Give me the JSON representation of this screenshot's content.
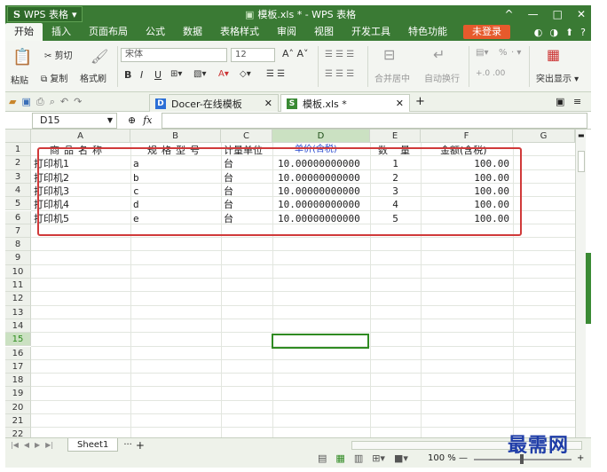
{
  "app": {
    "button_label": "WPS 表格",
    "logo_letter": "S",
    "window_title": "模板.xls * - WPS 表格",
    "controls": [
      "^",
      "—",
      "□",
      "✕"
    ]
  },
  "menu": {
    "tabs": [
      "开始",
      "插入",
      "页面布局",
      "公式",
      "数据",
      "表格样式",
      "审阅",
      "视图",
      "开发工具",
      "特色功能"
    ],
    "login_label": "未登录",
    "right_icons": [
      "◐",
      "◑",
      "⬆",
      "?"
    ]
  },
  "ribbon": {
    "paste": "粘贴",
    "cut": "剪切",
    "copy": "复制",
    "format_painter": "格式刷",
    "font_name": "宋体",
    "font_size": "12",
    "bold": "B",
    "italic": "I",
    "underline": "U",
    "merge_center": "合并居中",
    "wrap_text": "自动换行",
    "percent": "%",
    "highlight_duplicates": "突出显示"
  },
  "doctabs": [
    {
      "label": "Docer-在线模板",
      "icon": "D",
      "color": "#2b6fd6"
    },
    {
      "label": "模板.xls *",
      "icon": "S",
      "color": "#3a8a34"
    }
  ],
  "formula_bar": {
    "cell_ref": "D15",
    "fx_label": "fx",
    "formula": ""
  },
  "grid": {
    "columns": [
      "A",
      "B",
      "C",
      "D",
      "E",
      "F",
      "G"
    ],
    "rows": [
      "1",
      "2",
      "3",
      "4",
      "5",
      "6",
      "7",
      "8",
      "9",
      "10",
      "11",
      "12",
      "13",
      "14",
      "15",
      "16",
      "17",
      "18",
      "19",
      "20",
      "21",
      "22"
    ],
    "selected_column": "D",
    "selected_row": "15",
    "headers": [
      "商品名称",
      "规格型号",
      "计量单位",
      "单价(含税)",
      "数量",
      "金额(含税)"
    ],
    "data": [
      [
        "打印机1",
        "a",
        "台",
        "10.00000000000",
        "1",
        "100.00"
      ],
      [
        "打印机2",
        "b",
        "台",
        "10.00000000000",
        "2",
        "100.00"
      ],
      [
        "打印机3",
        "c",
        "台",
        "10.00000000000",
        "3",
        "100.00"
      ],
      [
        "打印机4",
        "d",
        "台",
        "10.00000000000",
        "4",
        "100.00"
      ],
      [
        "打印机5",
        "e",
        "台",
        "10.00000000000",
        "5",
        "100.00"
      ]
    ]
  },
  "sheets": {
    "active": "Sheet1"
  },
  "status": {
    "zoom": "100 %"
  },
  "watermark": "最需网"
}
